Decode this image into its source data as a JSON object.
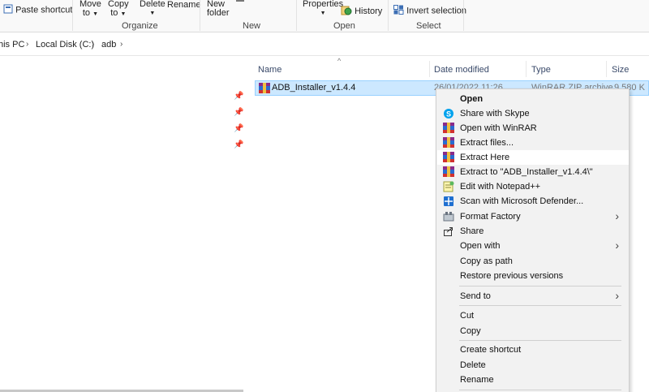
{
  "ribbon": {
    "paste_shortcut": "Paste shortcut",
    "move_to_line1": "Move",
    "move_to_line2": "to",
    "copy_to_line1": "Copy",
    "copy_to_line2": "to",
    "delete": "Delete",
    "rename": "Rename",
    "new_folder_line1": "New",
    "new_folder_line2": "folder",
    "properties": "Properties",
    "history": "History",
    "invert_selection": "Invert selection",
    "groups": {
      "organize": "Organize",
      "new": "New",
      "open": "Open",
      "select": "Select"
    }
  },
  "breadcrumb": {
    "items": [
      "his PC",
      "Local Disk (C:)",
      "adb"
    ]
  },
  "columns": {
    "name": "Name",
    "date_modified": "Date modified",
    "type": "Type",
    "size": "Size"
  },
  "file": {
    "name": "ADB_Installer_v1.4.4",
    "date_partial": "26/01/2022 11:26",
    "type_partial": "WinRAR ZIP archive",
    "size_partial": "9,580 K"
  },
  "context_menu": {
    "items": [
      {
        "label": "Open",
        "icon": "none"
      },
      {
        "label": "Share with Skype",
        "icon": "skype-icon"
      },
      {
        "label": "Open with WinRAR",
        "icon": "winrar-icon"
      },
      {
        "label": "Extract files...",
        "icon": "winrar-icon"
      },
      {
        "label": "Extract Here",
        "icon": "winrar-icon"
      },
      {
        "label": "Extract to \"ADB_Installer_v1.4.4\\\"",
        "icon": "winrar-icon"
      },
      {
        "label": "Edit with Notepad++",
        "icon": "notepad-plus-plus-icon"
      },
      {
        "label": "Scan with Microsoft Defender...",
        "icon": "defender-icon"
      },
      {
        "label": "Format Factory",
        "icon": "format-factory-icon"
      },
      {
        "label": "Share",
        "icon": "share-icon"
      },
      {
        "label": "Open with",
        "icon": "none"
      },
      {
        "label": "Copy as path",
        "icon": "none"
      },
      {
        "label": "Restore previous versions",
        "icon": "none"
      },
      {
        "label": "Send to",
        "icon": "none"
      },
      {
        "label": "Cut",
        "icon": "none"
      },
      {
        "label": "Copy",
        "icon": "none"
      },
      {
        "label": "Create shortcut",
        "icon": "none"
      },
      {
        "label": "Delete",
        "icon": "none"
      },
      {
        "label": "Rename",
        "icon": "none"
      }
    ]
  },
  "colors": {
    "selection_bg": "#cce8ff",
    "selection_border": "#99d1ff",
    "menu_bg": "#f2f2f2",
    "menu_hover": "#ffffff"
  }
}
